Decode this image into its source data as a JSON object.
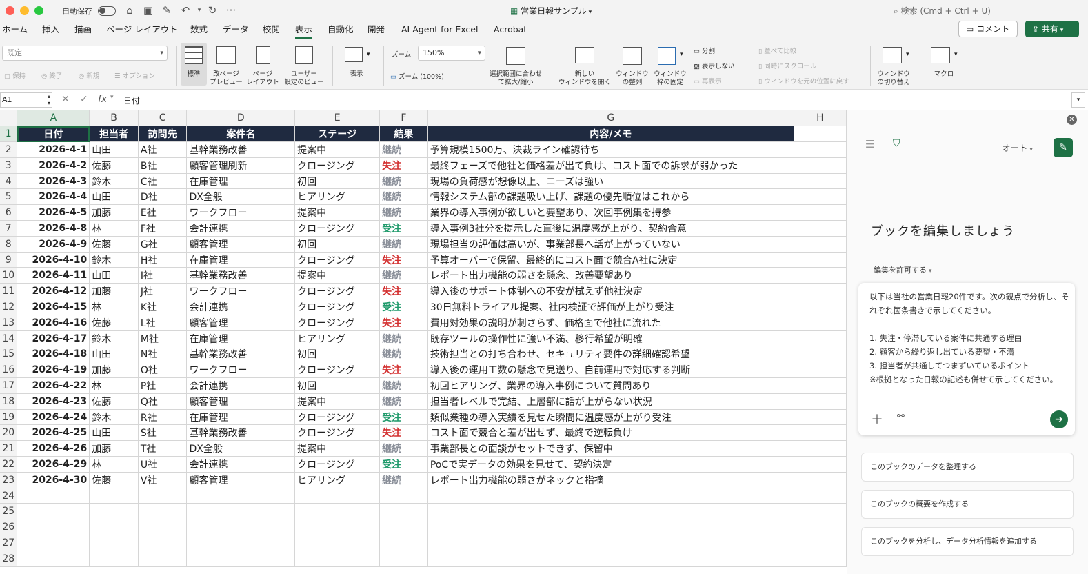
{
  "titlebar": {
    "autosave_label": "自動保存",
    "more": "···",
    "doc_title": "営業日報サンプル",
    "search_placeholder": "検索 (Cmd + Ctrl + U)"
  },
  "menu": {
    "tabs": [
      "ホーム",
      "挿入",
      "描画",
      "ページ レイアウト",
      "数式",
      "データ",
      "校閲",
      "表示",
      "自動化",
      "開発",
      "AI Agent for Excel",
      "Acrobat"
    ],
    "active_tab": "表示",
    "comment_button": "コメント",
    "share_button": "共有"
  },
  "ribbon": {
    "sheet_view_dropdown": "既定",
    "sheet_view_keep": "保持",
    "sheet_view_exit": "終了",
    "sheet_view_new": "新規",
    "sheet_view_options": "オプション",
    "normal": "標準",
    "page_break_1": "改ページ",
    "page_break_2": "プレビュー",
    "page_layout_1": "ページ",
    "page_layout_2": "レイアウト",
    "custom_view_1": "ユーザー",
    "custom_view_2": "設定のビュー",
    "show": "表示",
    "zoom_label": "ズーム",
    "zoom_value": "150%",
    "zoom_100": "ズーム (100%)",
    "zoom_selection_1": "選択範囲に合わせ",
    "zoom_selection_2": "て拡大/縮小",
    "new_window_1": "新しい",
    "new_window_2": "ウィンドウを開く",
    "arrange_1": "ウィンドウ",
    "arrange_2": "の整列",
    "freeze_1": "ウィンドウ",
    "freeze_2": "枠の固定",
    "split": "分割",
    "hide": "表示しない",
    "unhide": "再表示",
    "side_by_side": "並べて比較",
    "sync_scroll": "同時にスクロール",
    "reset_position": "ウィンドウを元の位置に戻す",
    "switch_window_1": "ウィンドウ",
    "switch_window_2": "の切り替え",
    "macros": "マクロ"
  },
  "formula_bar": {
    "name_box": "A1",
    "fx": "fx",
    "formula": "日付"
  },
  "sheet": {
    "columns": [
      "A",
      "B",
      "C",
      "D",
      "E",
      "F",
      "G",
      "H"
    ],
    "selected_column": "A",
    "header": [
      "日付",
      "担当者",
      "訪問先",
      "案件名",
      "ステージ",
      "結果",
      "内容/メモ"
    ],
    "rows": [
      [
        "2026-4-1",
        "山田",
        "A社",
        "基幹業務改善",
        "提案中",
        "継続",
        "予算規模1500万、決裁ライン確認待ち"
      ],
      [
        "2026-4-2",
        "佐藤",
        "B社",
        "顧客管理刷新",
        "クロージング",
        "失注",
        "最終フェーズで他社と価格差が出て負け、コスト面での訴求が弱かった"
      ],
      [
        "2026-4-3",
        "鈴木",
        "C社",
        "在庫管理",
        "初回",
        "継続",
        "現場の負荷感が想像以上、ニーズは強い"
      ],
      [
        "2026-4-4",
        "山田",
        "D社",
        "DX全般",
        "ヒアリング",
        "継続",
        "情報システム部の課題吸い上げ、課題の優先順位はこれから"
      ],
      [
        "2026-4-5",
        "加藤",
        "E社",
        "ワークフロー",
        "提案中",
        "継続",
        "業界の導入事例が欲しいと要望あり、次回事例集を持参"
      ],
      [
        "2026-4-8",
        "林",
        "F社",
        "会計連携",
        "クロージング",
        "受注",
        "導入事例3社分を提示した直後に温度感が上がり、契約合意"
      ],
      [
        "2026-4-9",
        "佐藤",
        "G社",
        "顧客管理",
        "初回",
        "継続",
        "現場担当の評価は高いが、事業部長へ話が上がっていない"
      ],
      [
        "2026-4-10",
        "鈴木",
        "H社",
        "在庫管理",
        "クロージング",
        "失注",
        "予算オーバーで保留、最終的にコスト面で競合A社に決定"
      ],
      [
        "2026-4-11",
        "山田",
        "I社",
        "基幹業務改善",
        "提案中",
        "継続",
        "レポート出力機能の弱さを懸念、改善要望あり"
      ],
      [
        "2026-4-12",
        "加藤",
        "J社",
        "ワークフロー",
        "クロージング",
        "失注",
        "導入後のサポート体制への不安が拭えず他社決定"
      ],
      [
        "2026-4-15",
        "林",
        "K社",
        "会計連携",
        "クロージング",
        "受注",
        "30日無料トライアル提案、社内検証で評価が上がり受注"
      ],
      [
        "2026-4-16",
        "佐藤",
        "L社",
        "顧客管理",
        "クロージング",
        "失注",
        "費用対効果の説明が刺さらず、価格面で他社に流れた"
      ],
      [
        "2026-4-17",
        "鈴木",
        "M社",
        "在庫管理",
        "ヒアリング",
        "継続",
        "既存ツールの操作性に強い不満、移行希望が明確"
      ],
      [
        "2026-4-18",
        "山田",
        "N社",
        "基幹業務改善",
        "初回",
        "継続",
        "技術担当との打ち合わせ、セキュリティ要件の詳細確認希望"
      ],
      [
        "2026-4-19",
        "加藤",
        "O社",
        "ワークフロー",
        "クロージング",
        "失注",
        "導入後の運用工数の懸念で見送り、自前運用で対応する判断"
      ],
      [
        "2026-4-22",
        "林",
        "P社",
        "会計連携",
        "初回",
        "継続",
        "初回ヒアリング、業界の導入事例について質問あり"
      ],
      [
        "2026-4-23",
        "佐藤",
        "Q社",
        "顧客管理",
        "提案中",
        "継続",
        "担当者レベルで完結、上層部に話が上がらない状況"
      ],
      [
        "2026-4-24",
        "鈴木",
        "R社",
        "在庫管理",
        "クロージング",
        "受注",
        "類似業種の導入実績を見せた瞬間に温度感が上がり受注"
      ],
      [
        "2026-4-25",
        "山田",
        "S社",
        "基幹業務改善",
        "クロージング",
        "失注",
        "コスト面で競合と差が出せず、最終で逆転負け"
      ],
      [
        "2026-4-26",
        "加藤",
        "T社",
        "DX全般",
        "提案中",
        "継続",
        "事業部長との面談がセットできず、保留中"
      ],
      [
        "2026-4-29",
        "林",
        "U社",
        "会計連携",
        "クロージング",
        "受注",
        "PoCで実データの効果を見せて、契約決定"
      ],
      [
        "2026-4-30",
        "佐藤",
        "V社",
        "顧客管理",
        "ヒアリング",
        "継続",
        "レポート出力機能の弱さがネックと指摘"
      ]
    ],
    "result_colors": {
      "継続": "#8a8f99",
      "失注": "#d32f2f",
      "受注": "#1f9a6b"
    },
    "header_bg": "#1f2a40"
  },
  "copilot": {
    "auto_label": "オート",
    "heading": "ブックを編集しましょう",
    "permission": "編集を許可する",
    "prompt": "以下は当社の営業日報20件です。次の観点で分析し、それぞれ箇条書きで示してください。\n\n1. 失注・停滞している案件に共通する理由\n2. 顧客から繰り返し出ている要望・不満\n3. 担当者が共通してつまずいているポイント\n※根拠となった日報の記述も併せて示してください。",
    "suggestions": [
      "このブックのデータを整理する",
      "このブックの概要を作成する",
      "このブックを分析し、データ分析情報を追加する"
    ]
  },
  "colors": {
    "accent": "#1e7145",
    "chrome": "#f3f3f3"
  }
}
